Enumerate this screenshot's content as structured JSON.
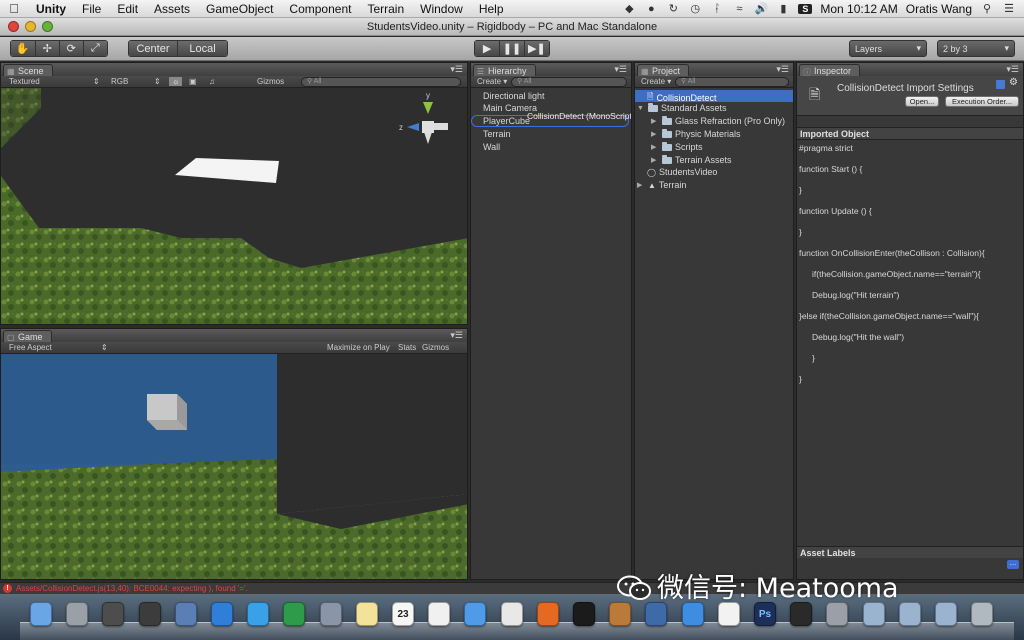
{
  "menubar": {
    "app": "Unity",
    "items": [
      "File",
      "Edit",
      "Assets",
      "GameObject",
      "Component",
      "Terrain",
      "Window",
      "Help"
    ],
    "clock": "Mon 10:12 AM",
    "user": "Oratis Wang"
  },
  "window": {
    "title": "StudentsVideo.unity – Rigidbody – PC and Mac Standalone"
  },
  "toolbar": {
    "pivot_center": "Center",
    "pivot_local": "Local",
    "layers": "Layers",
    "layout": "2 by 3"
  },
  "scene": {
    "tab": "Scene",
    "render_mode": "Textured",
    "color_mode": "RGB",
    "gizmos": "Gizmos",
    "search_placeholder": "All",
    "axis_y": "y",
    "axis_z": "z"
  },
  "game": {
    "tab": "Game",
    "aspect": "Free Aspect",
    "maximize": "Maximize on Play",
    "stats": "Stats",
    "gizmos": "Gizmos"
  },
  "hierarchy": {
    "tab": "Hierarchy",
    "create": "Create",
    "search_placeholder": "All",
    "items": [
      "Directional light",
      "Main Camera",
      "PlayerCube",
      "Terrain",
      "Wall"
    ],
    "drag_label": "CollisionDetect (MonoScript)"
  },
  "project": {
    "tab": "Project",
    "create": "Create",
    "search_placeholder": "All",
    "selected": "CollisionDetect",
    "standard_assets": "Standard Assets",
    "children": [
      "Glass Refraction (Pro Only)",
      "Physic Materials",
      "Scripts",
      "Terrain Assets"
    ],
    "students_video": "StudentsVideo",
    "terrain": "Terrain"
  },
  "inspector": {
    "tab": "Inspector",
    "title": "CollisionDetect Import Settings",
    "open_button": "Open...",
    "execution_order_button": "Execution Order...",
    "imported_object": "Imported Object",
    "code": [
      "#pragma strict",
      "function Start () {",
      "}",
      "function Update () {",
      "}",
      "function OnCollisionEnter(theCollison : Collision){",
      "if(theCollision.gameObject.name==\"terrain\"){",
      "Debug.log(\"Hit terrain\")",
      "}else if(theCollision.gameObject.name==\"wall\"){",
      "Debug.log(\"Hit the wall\")",
      "}",
      "}"
    ],
    "asset_labels": "Asset Labels"
  },
  "status": {
    "error": "Assets/CollisionDetect.js(13,40): BCE0044: expecting ), found '='."
  },
  "watermark": "微信号: Meatooma",
  "dock_icons": [
    "finder-icon",
    "launchpad-icon",
    "mission-control-icon",
    "dashboard-icon",
    "preview-icon",
    "safari-icon",
    "messages-icon",
    "facetime-icon",
    "mail-icon",
    "notes-icon",
    "calendar-icon",
    "reminders-icon",
    "itunes-icon",
    "chrome-icon",
    "firefox-icon",
    "qq-icon",
    "garageband-icon",
    "xcode-icon",
    "app-store-icon",
    "textedit-icon",
    "photoshop-icon",
    "unity-icon",
    "system-preferences-icon",
    "folder-icon",
    "documents-icon",
    "downloads-icon",
    "trash-icon"
  ],
  "dock_labels": {
    "calendar_day": "23",
    "photoshop": "Ps"
  }
}
